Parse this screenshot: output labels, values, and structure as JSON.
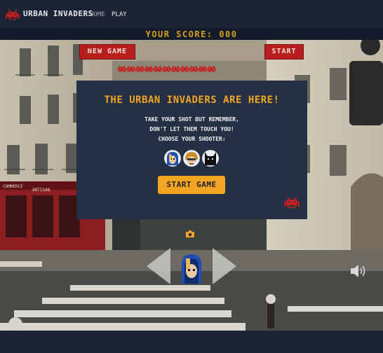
{
  "nav": {
    "brand": "URBAN INVADERS",
    "links": [
      "HOME",
      "PLAY"
    ],
    "icon": "invader-icon"
  },
  "score": {
    "text": "YOUR SCORE: 000"
  },
  "game": {
    "new_game_label": "NEW GAME",
    "start_label": "START",
    "invaders_remaining": 11
  },
  "modal": {
    "title": "THE URBAN INVADERS ARE HERE!",
    "line1": "TAKE YOUR SHOT BUT REMEMBER,",
    "line2": "DON'T LET THEM TOUCH YOU!",
    "line3": "CHOOSE YOUR SHOOTER:",
    "shooters": [
      "blue-hood-shooter-icon",
      "blonde-shooter-icon",
      "black-cat-shooter-icon"
    ],
    "start_label": "START GAME"
  },
  "shop_sign": {
    "left": "COMMERCE",
    "right": "ARTISAN"
  },
  "colors": {
    "nav_bg": "#1b2436",
    "score": "#d4a01a",
    "button_red": "#b81e1e",
    "modal_bg": "#243044",
    "accent": "#f4a524"
  }
}
